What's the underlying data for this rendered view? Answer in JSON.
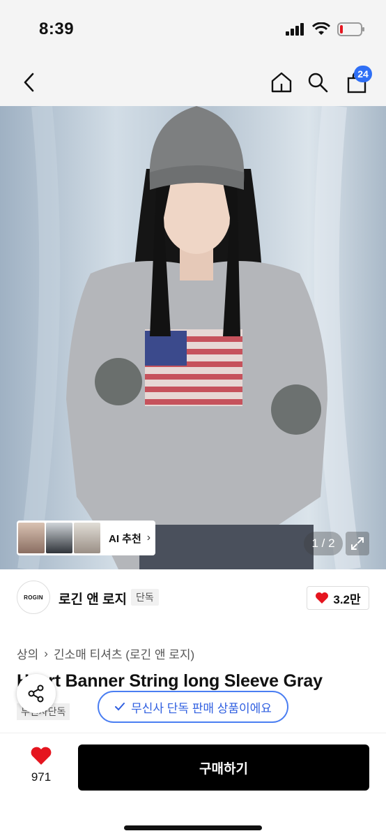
{
  "status": {
    "time": "8:39"
  },
  "nav": {
    "cart_count": "24"
  },
  "gallery": {
    "ai_label": "AI 추천",
    "page_counter": "1 / 2"
  },
  "brand": {
    "logo_text": "ROGIN",
    "name": "로긴 앤 로지",
    "exclusive_badge": "단독",
    "like_count": "3.2만"
  },
  "breadcrumb": [
    "상의",
    "긴소매 티셔츠 (로긴 앤 로지)"
  ],
  "product": {
    "title": "Heart Banner String long Sleeve Gray",
    "badge": "무신사단독"
  },
  "toast": {
    "label": "무신사 단독 판매 상품이에요"
  },
  "bottom": {
    "wish_count": "971",
    "buy_label": "구매하기"
  },
  "colors": {
    "accent": "#2f6ff5",
    "heart": "#e5151f",
    "buy": "#000000"
  }
}
